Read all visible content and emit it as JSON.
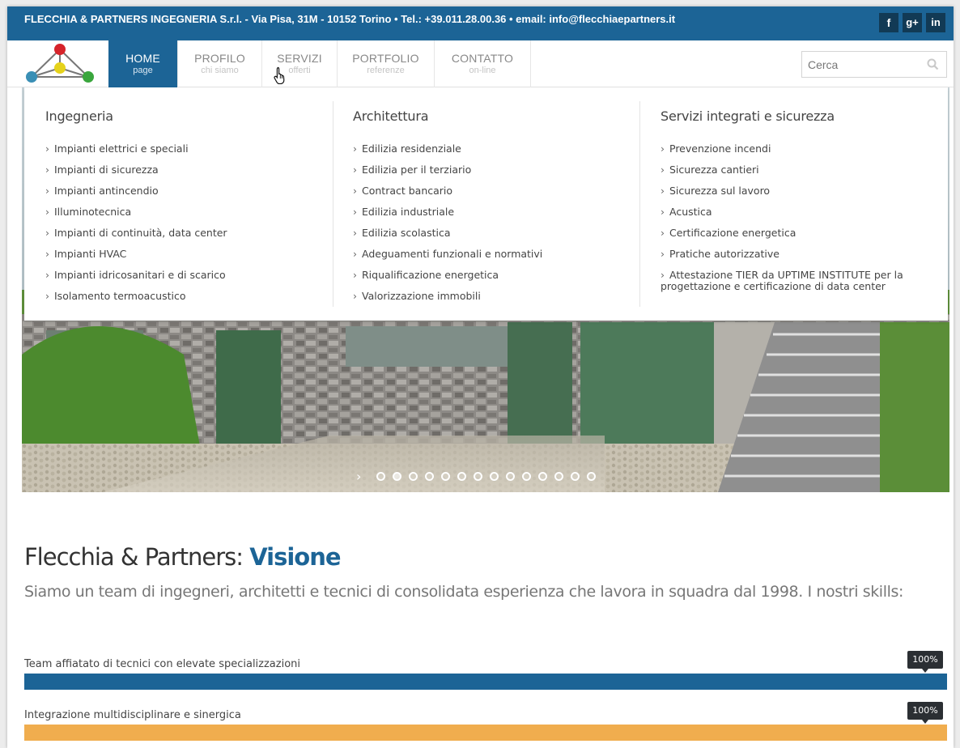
{
  "topbar": {
    "info": "FLECCHIA & PARTNERS INGEGNERIA S.r.l. - Via Pisa, 31M - 10152 Torino • Tel.: +39.011.28.00.36 • email: info@flecchiaepartners.it",
    "social": {
      "facebook": "f",
      "googleplus": "g+",
      "linkedin": "in"
    }
  },
  "nav": {
    "home": {
      "label": "HOME",
      "sub": "page"
    },
    "profilo": {
      "label": "PROFILO",
      "sub": "chi siamo"
    },
    "servizi": {
      "label": "SERVIZI",
      "sub": "offerti"
    },
    "portfolio": {
      "label": "PORTFOLIO",
      "sub": "referenze"
    },
    "contatto": {
      "label": "CONTATTO",
      "sub": "on-line"
    }
  },
  "search": {
    "placeholder": "Cerca"
  },
  "mega_menu": {
    "columns": [
      {
        "title": "Ingegneria",
        "items": [
          "Impianti elettrici e speciali",
          "Impianti di sicurezza",
          "Impianti antincendio",
          "Illuminotecnica",
          "Impianti di continuità, data center",
          "Impianti HVAC",
          "Impianti idricosanitari e di scarico",
          "Isolamento termoacustico"
        ]
      },
      {
        "title": "Architettura",
        "items": [
          "Edilizia residenziale",
          "Edilizia per il terziario",
          "Contract bancario",
          "Edilizia industriale",
          "Edilizia scolastica",
          "Adeguamenti funzionali e normativi",
          "Riqualificazione energetica",
          "Valorizzazione immobili"
        ]
      },
      {
        "title": "Servizi integrati e sicurezza",
        "items": [
          "Prevenzione incendi",
          "Sicurezza cantieri",
          "Sicurezza sul lavoro",
          "Acustica",
          "Certificazione energetica",
          "Pratiche autorizzative",
          "Attestazione TIER da UPTIME INSTITUTE per la progettazione e certificazione di data center"
        ]
      }
    ]
  },
  "slider": {
    "dot_count": 14,
    "active_dot": 1
  },
  "content": {
    "title_prefix": "Flecchia & Partners: ",
    "title_highlight": "Visione",
    "lead": "Siamo un team di ingegneri, architetti e tecnici di consolidata esperienza che lavora in squadra dal 1998. I nostri skills:",
    "skills": [
      {
        "label": "Team affiatato di tecnici con elevate specializzazioni",
        "percent": 100,
        "percent_label": "100%",
        "color": "#1c6496"
      },
      {
        "label": "Integrazione multidisciplinare e sinergica",
        "percent": 100,
        "percent_label": "100%",
        "color": "#f0ad4e"
      }
    ]
  }
}
